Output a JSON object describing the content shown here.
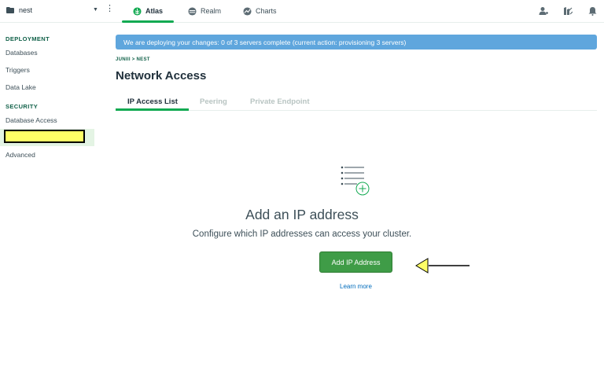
{
  "topbar": {
    "project_name": "nest",
    "tabs": [
      {
        "label": "Atlas",
        "active": true
      },
      {
        "label": "Realm",
        "active": false
      },
      {
        "label": "Charts",
        "active": false
      }
    ],
    "icons": [
      "add-user-icon",
      "activity-feed-icon",
      "notifications-bell-icon"
    ]
  },
  "sidebar": {
    "deployment_title": "DEPLOYMENT",
    "deployment_items": [
      "Databases",
      "Triggers",
      "Data Lake"
    ],
    "security_title": "SECURITY",
    "security_items": [
      "Database Access",
      "",
      "Advanced"
    ]
  },
  "main": {
    "banner": "We are deploying your changes: 0 of 3 servers complete (current action: provisioning 3 servers)",
    "breadcrumb": "JUNIII > NEST",
    "title": "Network Access",
    "tabs": [
      "IP Access List",
      "Peering",
      "Private Endpoint"
    ],
    "empty_title": "Add an IP address",
    "empty_subtitle": "Configure which IP addresses can access your cluster.",
    "add_button": "Add IP Address",
    "learn_more": "Learn more"
  },
  "colors": {
    "accent_green": "#13aa52",
    "button_green": "#3f9c47",
    "banner_blue": "#5fa6dd",
    "highlight_yellow": "#ffff66"
  }
}
